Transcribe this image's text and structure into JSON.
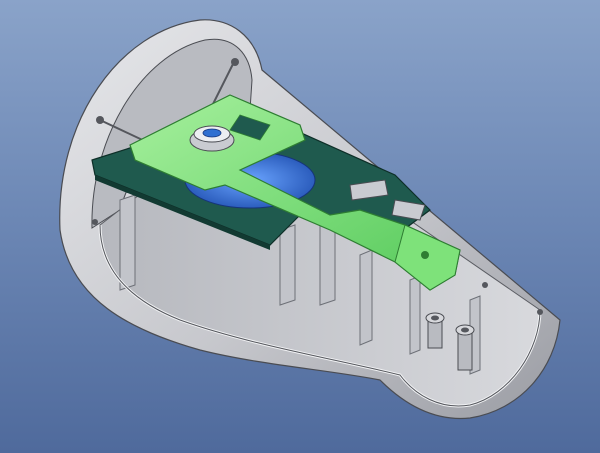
{
  "scene": {
    "background_top": "#8aa3c9",
    "background_bottom": "#4f6a9c",
    "housing_color": "#c8c9ce",
    "housing_shadow": "#8d8f96",
    "bracket_color": "#7fe07a",
    "plate_color": "#1f5a4e",
    "hub_color": "#2f6fd1",
    "bearing_color": "#d9dbe0"
  }
}
